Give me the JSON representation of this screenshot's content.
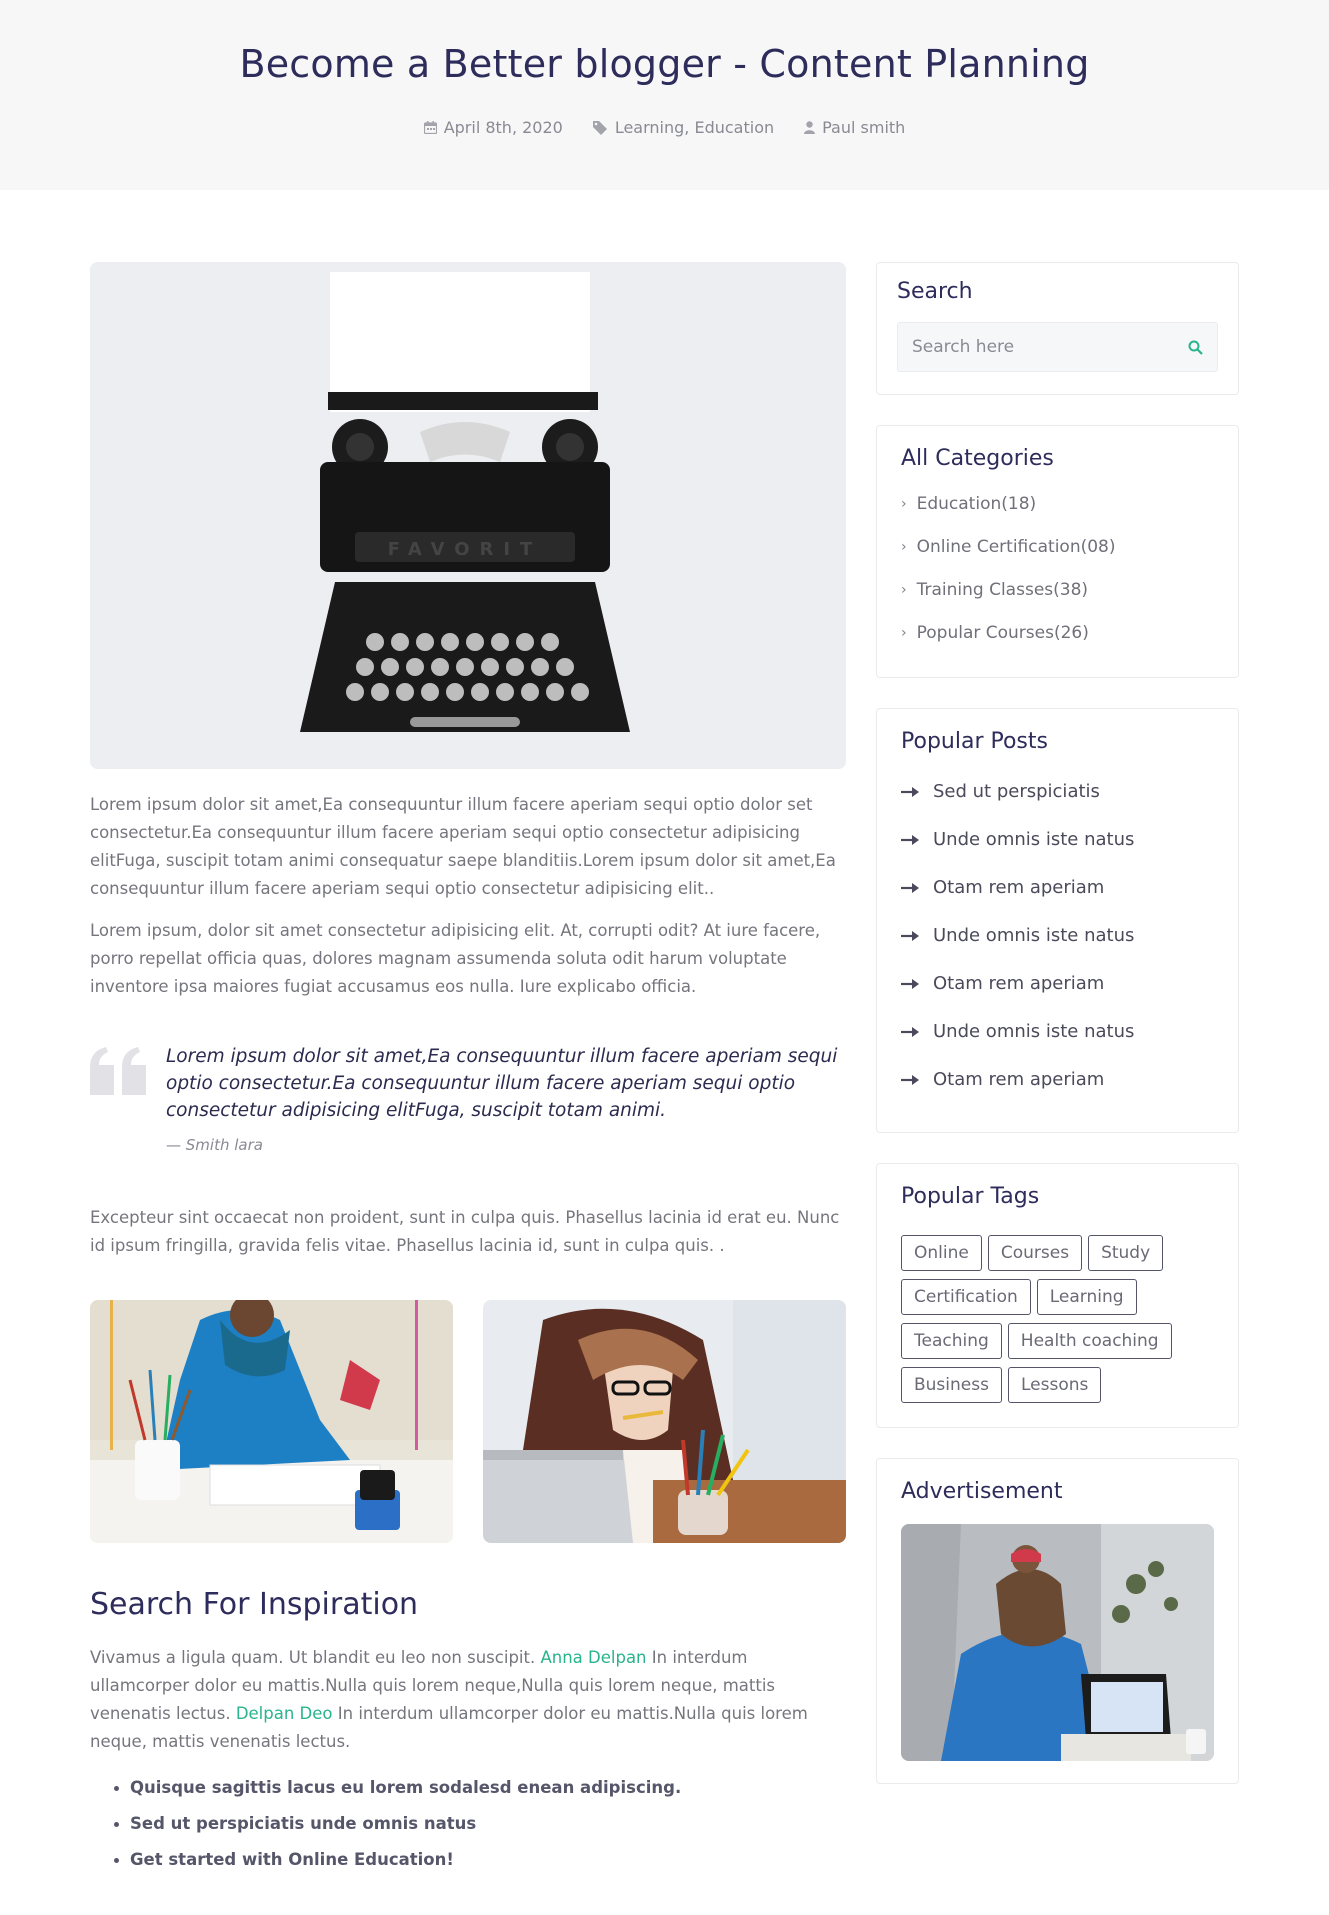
{
  "post": {
    "title": "Become a Better blogger - Content Planning",
    "date": "April 8th, 2020",
    "categories": "Learning, Education",
    "author": "Paul smith"
  },
  "content": {
    "para1": "Lorem ipsum dolor sit amet,Ea consequuntur illum facere aperiam sequi optio dolor set consectetur.Ea consequuntur illum facere aperiam sequi optio consectetur adipisicing elitFuga, suscipit totam animi consequatur saepe blanditiis.Lorem ipsum dolor sit amet,Ea consequuntur illum facere aperiam sequi optio consectetur adipisicing elit..",
    "para2": "Lorem ipsum, dolor sit amet consectetur adipisicing elit. At, corrupti odit? At iure facere, porro repellat officia quas, dolores magnam assumenda soluta odit harum voluptate inventore ipsa maiores fugiat accusamus eos nulla. Iure explicabo officia.",
    "quote_text": "Lorem ipsum dolor sit amet,Ea consequuntur illum facere aperiam sequi optio consectetur.Ea consequuntur illum facere aperiam sequi optio consectetur adipisicing elitFuga, suscipit totam animi.",
    "quote_author": "— Smith lara",
    "para3": "Excepteur sint occaecat non proident, sunt in culpa quis. Phasellus lacinia id erat eu. Nunc id ipsum fringilla, gravida felis vitae. Phasellus lacinia id, sunt in culpa quis. .",
    "section_title": "Search For Inspiration",
    "para4_a": "Vivamus a ligula quam. Ut blandit eu leo non suscipit. ",
    "link1": "Anna Delpan",
    "para4_b": " In interdum ullamcorper dolor eu mattis.Nulla quis lorem neque,Nulla quis lorem neque, mattis venenatis lectus. ",
    "link2": "Delpan Deo",
    "para4_c": " In interdum ullamcorper dolor eu mattis.Nulla quis lorem neque, mattis venenatis lectus.",
    "bullets": [
      "Quisque sagittis lacus eu lorem sodalesd enean adipiscing.",
      "Sed ut perspiciatis unde omnis natus",
      "Get started with Online Education!"
    ]
  },
  "sidebar": {
    "search_title": "Search",
    "search_placeholder": "Search here",
    "categories_title": "All Categories",
    "categories": [
      "Education(18)",
      "Online Certification(08)",
      "Training Classes(38)",
      "Popular Courses(26)"
    ],
    "posts_title": "Popular Posts",
    "posts": [
      "Sed ut perspiciatis",
      "Unde omnis iste natus",
      "Otam rem aperiam",
      "Unde omnis iste natus",
      "Otam rem aperiam",
      "Unde omnis iste natus",
      "Otam rem aperiam"
    ],
    "tags_title": "Popular Tags",
    "tags": [
      "Online",
      "Courses",
      "Study",
      "Certification",
      "Learning",
      "Teaching",
      "Health coaching",
      "Business",
      "Lessons"
    ],
    "ad_title": "Advertisement"
  },
  "colors": {
    "heading": "#2e2c5b",
    "accent": "#28b48c",
    "hero_bg": "#f7f7f7"
  },
  "icons": [
    "calendar-icon",
    "tag-icon",
    "user-icon",
    "search-icon",
    "chevron-right-icon",
    "arrow-right-icon",
    "quote-icon"
  ]
}
